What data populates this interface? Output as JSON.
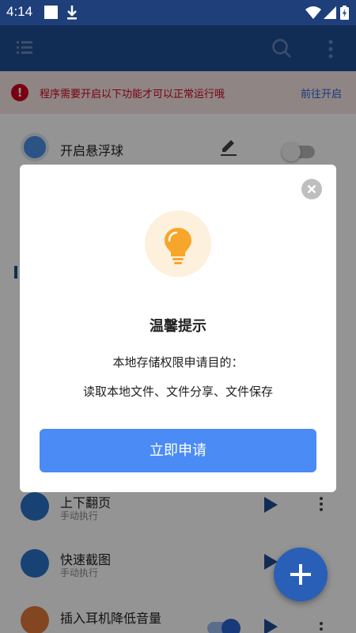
{
  "status_bar": {
    "time": "4:14"
  },
  "warning": {
    "message": "程序需要开启以下功能才可以正常运行哦",
    "action": "前往开启"
  },
  "list": {
    "rows": [
      {
        "title": "开启悬浮球"
      },
      {
        "title": "上下翻页",
        "subtitle": "手动执行"
      },
      {
        "title": "快速截图",
        "subtitle": "手动执行"
      },
      {
        "title": "插入耳机降低音量"
      }
    ]
  },
  "dialog": {
    "title": "温馨提示",
    "line1": "本地存储权限申请目的：",
    "line2": "读取本地文件、文件分享、文件保存",
    "button": "立即申请"
  },
  "colors": {
    "status_bar": "#1e3f7a",
    "app_bar": "#1f4f93",
    "warning_red": "#d0021b",
    "link_blue": "#2a62d3",
    "dialog_button": "#4a8bf5"
  }
}
